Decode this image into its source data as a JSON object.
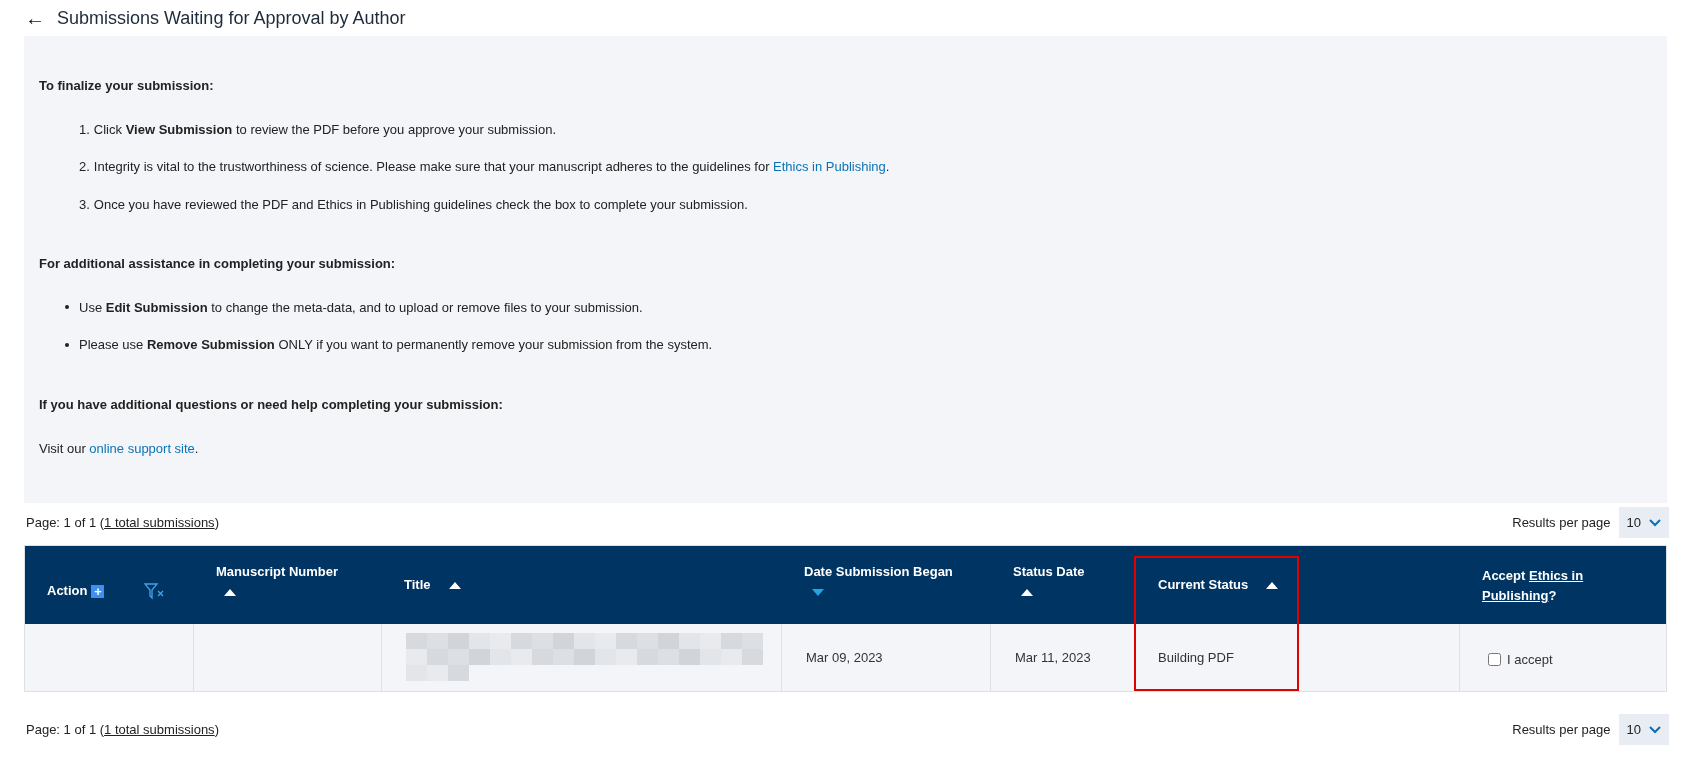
{
  "header": {
    "back": "←",
    "title": "Submissions Waiting for Approval by Author"
  },
  "instructions": {
    "heading_1": "To finalize your submission:",
    "steps": [
      {
        "number": "1.",
        "text": "Click **View Submission** to review the PDF before you approve your submission."
      },
      {
        "number": "2.",
        "text": "Integrity is vital to the trustworthiness of science. Please make sure that your manuscript adheres to the guidelines for ",
        "link": "Ethics in Publishing",
        "trail": "."
      },
      {
        "number": "3.",
        "text": "Once you have reviewed the PDF and Ethics in Publishing guidelines check the box to complete your submission."
      }
    ],
    "heading_2": "For additional assistance in completing your submission:",
    "bullets": [
      "Use **Edit Submission** to change the meta-data, and to upload or remove files to your submission.",
      "Please use **Remove Submission** ONLY if you want to permanently remove your submission from the system."
    ],
    "heading_3": "If you have additional questions or need help completing your submission:",
    "visit": {
      "text": "Visit our ",
      "link": "online support site",
      "trail": "."
    }
  },
  "pager_top": {
    "page": "Page: 1 of 1 (",
    "total": "1 total submissions",
    "close": ")",
    "results_label": "Results per page",
    "per_page": "10"
  },
  "table": {
    "columns": [
      {
        "kind": "action",
        "label": "Action",
        "add": "+"
      },
      {
        "kind": "sort",
        "label": "Manuscript Number",
        "descending": false,
        "active": false,
        "highlighted": false,
        "stacked": true
      },
      {
        "kind": "sort",
        "label": "Title",
        "descending": false,
        "active": false,
        "highlighted": false,
        "stacked": false
      },
      {
        "kind": "sort",
        "label": "Date Submission Began",
        "descending": true,
        "active": true,
        "highlighted": false,
        "stacked": true
      },
      {
        "kind": "sort",
        "label": "Status Date",
        "descending": false,
        "active": false,
        "highlighted": false,
        "stacked": true
      },
      {
        "kind": "sort",
        "label": "Current Status",
        "descending": false,
        "active": false,
        "highlighted": true,
        "stacked": false
      },
      {
        "kind": "accept",
        "label": "Accept ",
        "link_lines": [
          "Ethics in",
          "Publishing"
        ],
        "trail": "?"
      }
    ],
    "rows": [
      {
        "date_began": "Mar 09, 2023",
        "status_date": "Mar 11, 2023",
        "status": "Building PDF",
        "accept_label": "I accept",
        "checked": false
      }
    ]
  },
  "pager_bottom": {
    "page": "Page: 1 of 1 (",
    "total": "1 total submissions",
    "close": ")",
    "results_label": "Results per page",
    "per_page": "10"
  }
}
